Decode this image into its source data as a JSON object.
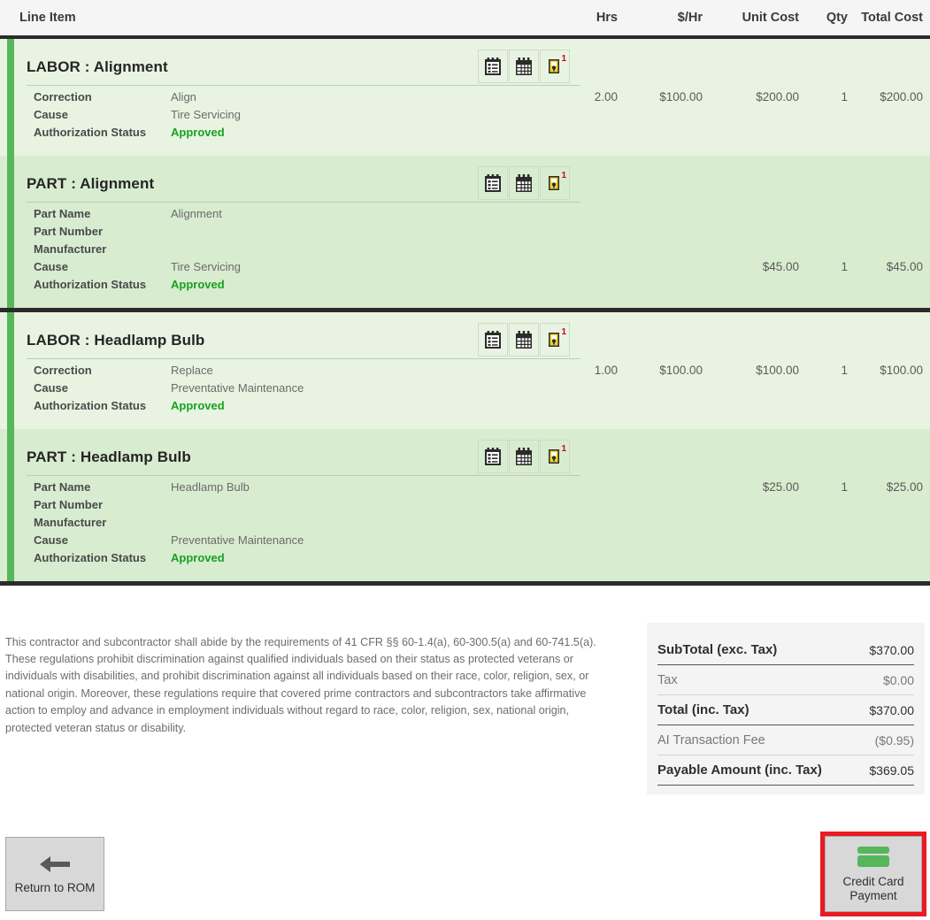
{
  "table": {
    "columns": {
      "line_item": "Line Item",
      "hrs": "Hrs",
      "rate": "$/Hr",
      "unit_cost": "Unit Cost",
      "qty": "Qty",
      "total_cost": "Total Cost"
    }
  },
  "icons": {
    "notes": "clipboard-notes-icon",
    "calendar": "calendar-icon",
    "comment": "sticky-note-comment-icon",
    "comment_badge": "1"
  },
  "groups": [
    {
      "lines": [
        {
          "kind": "labor",
          "title": "LABOR : Alignment",
          "details": [
            {
              "key": "Correction",
              "value": "Align",
              "state": ""
            },
            {
              "key": "Cause",
              "value": "Tire Servicing",
              "state": ""
            },
            {
              "key": "Authorization Status",
              "value": "Approved",
              "state": "approved"
            }
          ],
          "hrs": "2.00",
          "rate": "$100.00",
          "unit_cost": "$200.00",
          "qty": "1",
          "total_cost": "$200.00"
        },
        {
          "kind": "part",
          "title": "PART : Alignment",
          "details": [
            {
              "key": "Part Name",
              "value": "Alignment",
              "state": ""
            },
            {
              "key": "Part Number",
              "value": "",
              "state": ""
            },
            {
              "key": "Manufacturer",
              "value": "",
              "state": ""
            },
            {
              "key": "Cause",
              "value": "Tire Servicing",
              "state": ""
            },
            {
              "key": "Authorization Status",
              "value": "Approved",
              "state": "approved"
            }
          ],
          "hrs": "",
          "rate": "",
          "unit_cost": "$45.00",
          "qty": "1",
          "total_cost": "$45.00",
          "numbers_offset": 3
        }
      ]
    },
    {
      "lines": [
        {
          "kind": "labor",
          "title": "LABOR : Headlamp Bulb",
          "details": [
            {
              "key": "Correction",
              "value": "Replace",
              "state": ""
            },
            {
              "key": "Cause",
              "value": "Preventative Maintenance",
              "state": ""
            },
            {
              "key": "Authorization Status",
              "value": "Approved",
              "state": "approved"
            }
          ],
          "hrs": "1.00",
          "rate": "$100.00",
          "unit_cost": "$100.00",
          "qty": "1",
          "total_cost": "$100.00"
        },
        {
          "kind": "part",
          "title": "PART : Headlamp Bulb",
          "details": [
            {
              "key": "Part Name",
              "value": "Headlamp Bulb",
              "state": ""
            },
            {
              "key": "Part Number",
              "value": "",
              "state": ""
            },
            {
              "key": "Manufacturer",
              "value": "",
              "state": ""
            },
            {
              "key": "Cause",
              "value": "Preventative Maintenance",
              "state": ""
            },
            {
              "key": "Authorization Status",
              "value": "Approved",
              "state": "approved"
            }
          ],
          "hrs": "",
          "rate": "",
          "unit_cost": "$25.00",
          "qty": "1",
          "total_cost": "$25.00",
          "numbers_offset": 0
        }
      ]
    }
  ],
  "legal": {
    "text": "This contractor and subcontractor shall abide by the requirements of 41 CFR §§ 60-1.4(a), 60-300.5(a) and 60-741.5(a). These regulations prohibit discrimination against qualified individuals based on their status as protected veterans or individuals with disabilities, and prohibit discrimination against all individuals based on their race, color, religion, sex, or national origin. Moreover, these regulations require that covered prime contractors and subcontractors take affirmative action to employ and advance in employment individuals without regard to race, color, religion, sex, national origin, protected veteran status or disability."
  },
  "totals": [
    {
      "label": "SubTotal (exc. Tax)",
      "value": "$370.00",
      "style": "strong"
    },
    {
      "label": "Tax",
      "value": "$0.00",
      "style": "light"
    },
    {
      "label": "Total (inc. Tax)",
      "value": "$370.00",
      "style": "strong"
    },
    {
      "label": "AI Transaction Fee",
      "value": "($0.95)",
      "style": "light"
    },
    {
      "label": "Payable Amount (inc. Tax)",
      "value": "$369.05",
      "style": "strong"
    }
  ],
  "actions": {
    "return_label": "Return to ROM",
    "credit_card_label": "Credit Card\nPayment",
    "credit_card_label_line1": "Credit Card",
    "credit_card_label_line2": "Payment"
  },
  "colors": {
    "accent_green": "#57b75b",
    "labor_bg": "#e8f4e1",
    "part_bg": "#d8ecd0",
    "approved_green": "#17a120",
    "divider_dark": "#2b2b2b",
    "highlight_red": "#e81b23",
    "card_green": "#56b65a"
  }
}
